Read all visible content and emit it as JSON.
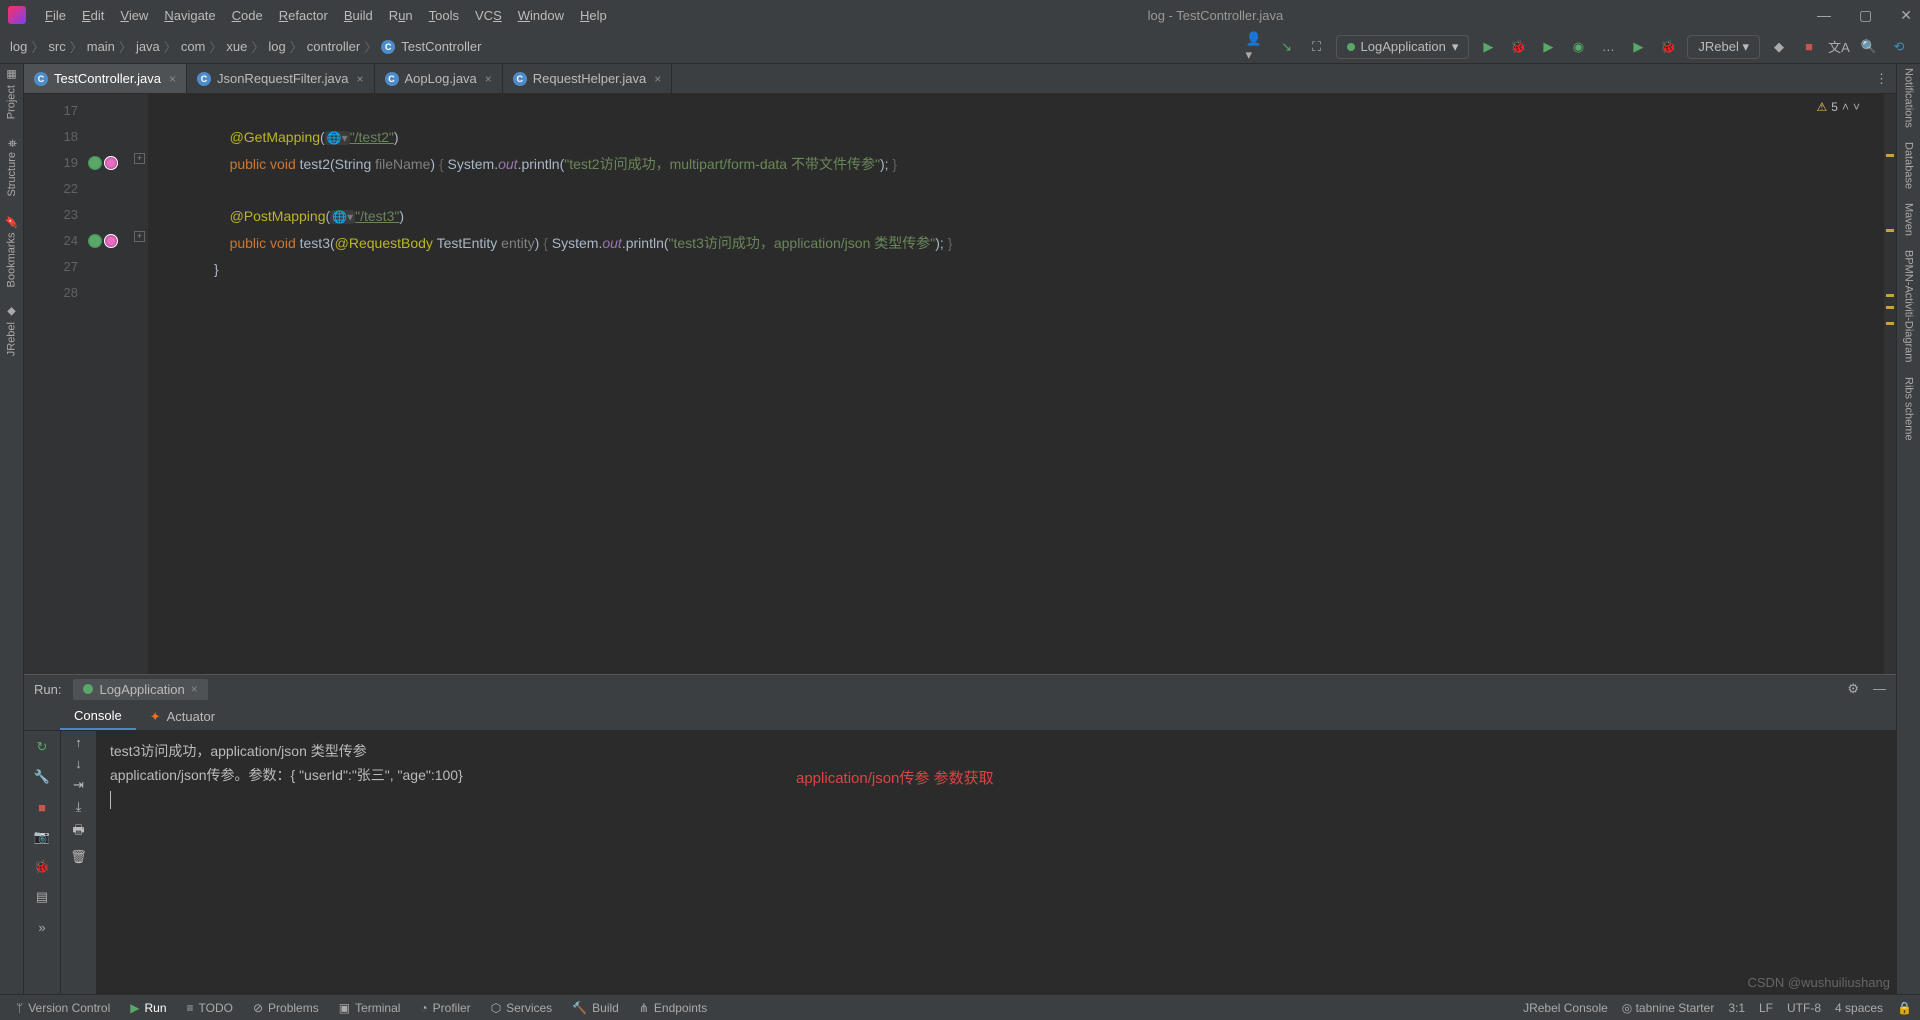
{
  "window": {
    "title": "log - TestController.java"
  },
  "menu": [
    "File",
    "Edit",
    "View",
    "Navigate",
    "Code",
    "Refactor",
    "Build",
    "Run",
    "Tools",
    "VCS",
    "Window",
    "Help"
  ],
  "breadcrumbs": [
    "log",
    "src",
    "main",
    "java",
    "com",
    "xue",
    "log",
    "controller",
    "TestController"
  ],
  "runConfig": "LogApplication",
  "jrebel": "JRebel",
  "tabs": [
    {
      "label": "TestController.java",
      "active": true
    },
    {
      "label": "JsonRequestFilter.java",
      "active": false
    },
    {
      "label": "AopLog.java",
      "active": false
    },
    {
      "label": "RequestHelper.java",
      "active": false
    }
  ],
  "warnings": {
    "count": "5"
  },
  "gutter": [
    "17",
    "18",
    "19",
    "22",
    "23",
    "24",
    "27",
    "28"
  ],
  "code": {
    "l18_ann": "@GetMapping",
    "l18_url": "\"/test2\"",
    "l19_kw1": "public",
    "l19_kw2": "void",
    "l19_m": "test2",
    "l19_pt": "String",
    "l19_pn": "fileName",
    "l19_sys": "System",
    "l19_out": "out",
    "l19_pr": "println",
    "l19_s": "\"test2访问成功，multipart/form-data 不带文件传参\"",
    "l23_ann": "@PostMapping",
    "l23_url": "\"/test3\"",
    "l24_kw1": "public",
    "l24_kw2": "void",
    "l24_m": "test3",
    "l24_rb": "@RequestBody",
    "l24_pt": "TestEntity",
    "l24_pn": "entity",
    "l24_sys": "System",
    "l24_out": "out",
    "l24_pr": "println",
    "l24_s": "\"test3访问成功，application/json 类型传参\"",
    "l27": "}"
  },
  "runPanel": {
    "title": "Run:",
    "config": "LogApplication",
    "tabs": {
      "console": "Console",
      "actuator": "Actuator"
    },
    "console": {
      "line1": "test3访问成功，application/json 类型传参",
      "line2": "application/json传参。参数：{    \"userId\":\"张三\",    \"age\":100}",
      "annotation": "application/json传参 参数获取"
    }
  },
  "leftTools": [
    "Project",
    "Structure",
    "Bookmarks",
    "JRebel"
  ],
  "rightTools": [
    "Notifications",
    "Database",
    "Maven",
    "BPMN-Activiti-Diagram",
    "Ribs scheme"
  ],
  "statusbar": {
    "items": [
      "Version Control",
      "Run",
      "TODO",
      "Problems",
      "Terminal",
      "Profiler",
      "Services",
      "Build",
      "Endpoints"
    ],
    "jrebelConsole": "JRebel Console",
    "tabnine": "tabnine Starter",
    "pos": "3:1",
    "lf": "LF",
    "enc": "UTF-8",
    "indent": "4 spaces"
  },
  "watermark": "CSDN @wushuiliushang"
}
